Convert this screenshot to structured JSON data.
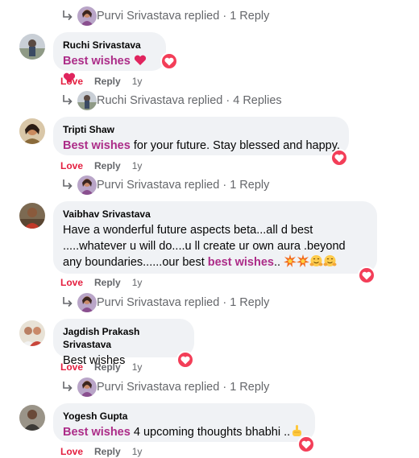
{
  "actions": {
    "love": "Love",
    "reply": "Reply"
  },
  "thread_top": {
    "reply_summary": "Purvi Srivastava replied · 1 Reply"
  },
  "comments": [
    {
      "author": "Ruchi Srivastava",
      "highlight": "Best wishes",
      "text": "",
      "emojis": [
        "red-heart",
        "red-heart"
      ],
      "time": "1y",
      "reaction": "love",
      "reply_summary": "Ruchi Srivastava replied · 4 Replies"
    },
    {
      "author": "Tripti Shaw",
      "highlight": "Best wishes",
      "text": " for your future. Stay blessed and happy.",
      "time": "1y",
      "reaction": "love",
      "reply_summary": "Purvi Srivastava replied · 1 Reply"
    },
    {
      "author": "Vaibhav Srivastava",
      "line1": "Have a wonderful future aspects beta...all d best",
      "line2": ".....whatever u will do....u ll create ur own aura .beyond",
      "line3_prefix": "any boundaries......our best ",
      "highlight": "best wishes",
      "line3_suffix": ".. ",
      "emojis": [
        "collision",
        "collision",
        "hugging-face",
        "hugging-face"
      ],
      "time": "1y",
      "reaction": "love",
      "reply_summary": "Purvi Srivastava replied · 1 Reply"
    },
    {
      "author": "Jagdish Prakash Srivastava",
      "text": "Best wishes",
      "time": "1y",
      "reaction": "love",
      "reply_summary": "Purvi Srivastava replied · 1 Reply"
    },
    {
      "author": "Yogesh Gupta",
      "highlight": "Best wishes",
      "text": " 4 upcoming thoughts bhabhi ..",
      "emojis": [
        "pointing-hand"
      ],
      "time": "1y",
      "reaction": "love"
    }
  ],
  "colors": {
    "bubble": "#f0f2f5",
    "highlight": "#ac2c88",
    "love": "#e41e3f",
    "meta": "#65676b",
    "heart": "#f33e58"
  }
}
